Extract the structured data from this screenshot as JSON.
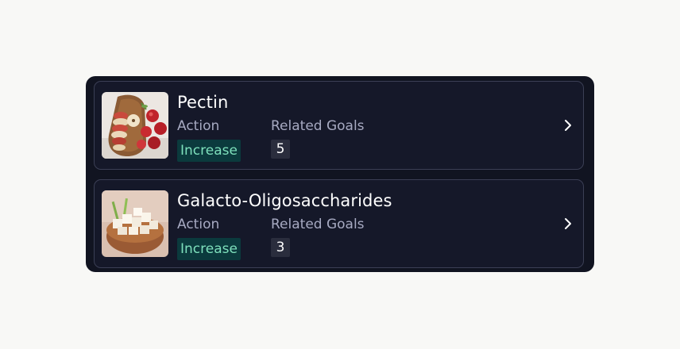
{
  "items": [
    {
      "title": "Pectin",
      "action_label": "Action",
      "action_value": "Increase",
      "goals_label": "Related Goals",
      "goals_count": "5",
      "image": "apple-slices-image"
    },
    {
      "title": "Galacto-Oligosaccharides",
      "action_label": "Action",
      "action_value": "Increase",
      "goals_label": "Related Goals",
      "goals_count": "3",
      "image": "tofu-bowl-image"
    }
  ],
  "colors": {
    "panel": "#111421",
    "card_border": "#3b3f55",
    "action_text": "#7ee0bc",
    "action_bg": "#0b3a3d",
    "count_bg": "#2a2d3d"
  },
  "icons": {
    "chevron": "chevron-right-icon"
  }
}
